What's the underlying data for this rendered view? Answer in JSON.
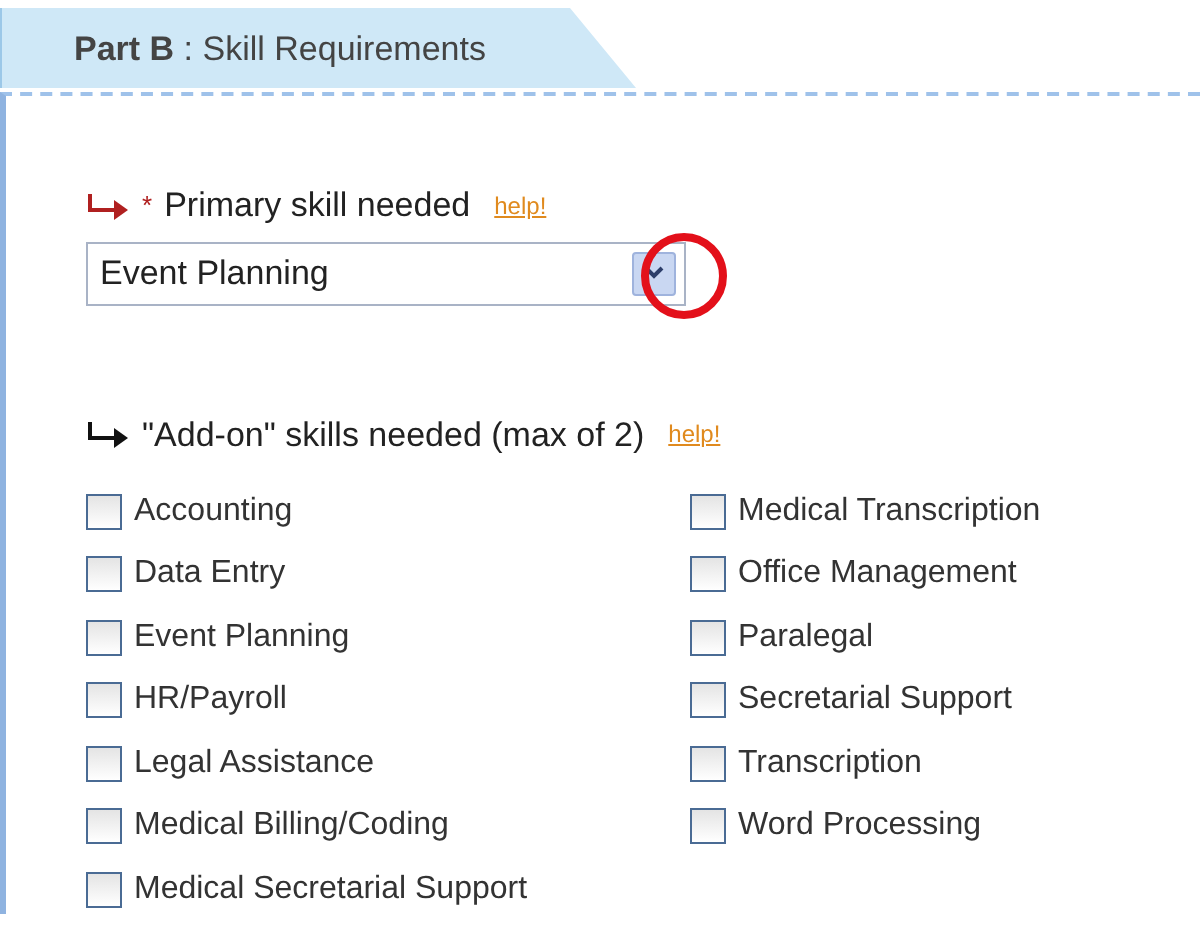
{
  "tab": {
    "title": "**Part B** : Skill Requirements",
    "selected": true
  },
  "primary_skill": {
    "required_mark": "*",
    "label": "Primary skill needed",
    "help": "help!",
    "value": "Event Planning",
    "highlighted": true
  },
  "addon_skills": {
    "label": "\"Add-on\" skills needed (max of 2)",
    "help": "help!",
    "options": [
      {
        "label": "Accounting",
        "checked": false
      },
      {
        "label": "Data Entry",
        "checked": false
      },
      {
        "label": "Event Planning",
        "checked": false
      },
      {
        "label": "HR/Payroll",
        "checked": false
      },
      {
        "label": "Legal Assistance",
        "checked": false
      },
      {
        "label": "Medical Billing/Coding",
        "checked": false
      },
      {
        "label": "Medical Secretarial Support",
        "checked": false
      },
      {
        "label": "Medical Transcription",
        "checked": false
      },
      {
        "label": "Office Management",
        "checked": false
      },
      {
        "label": "Paralegal",
        "checked": false
      },
      {
        "label": "Secretarial Support",
        "checked": false
      },
      {
        "label": "Transcription",
        "checked": false
      },
      {
        "label": "Word Processing",
        "checked": false
      }
    ]
  }
}
